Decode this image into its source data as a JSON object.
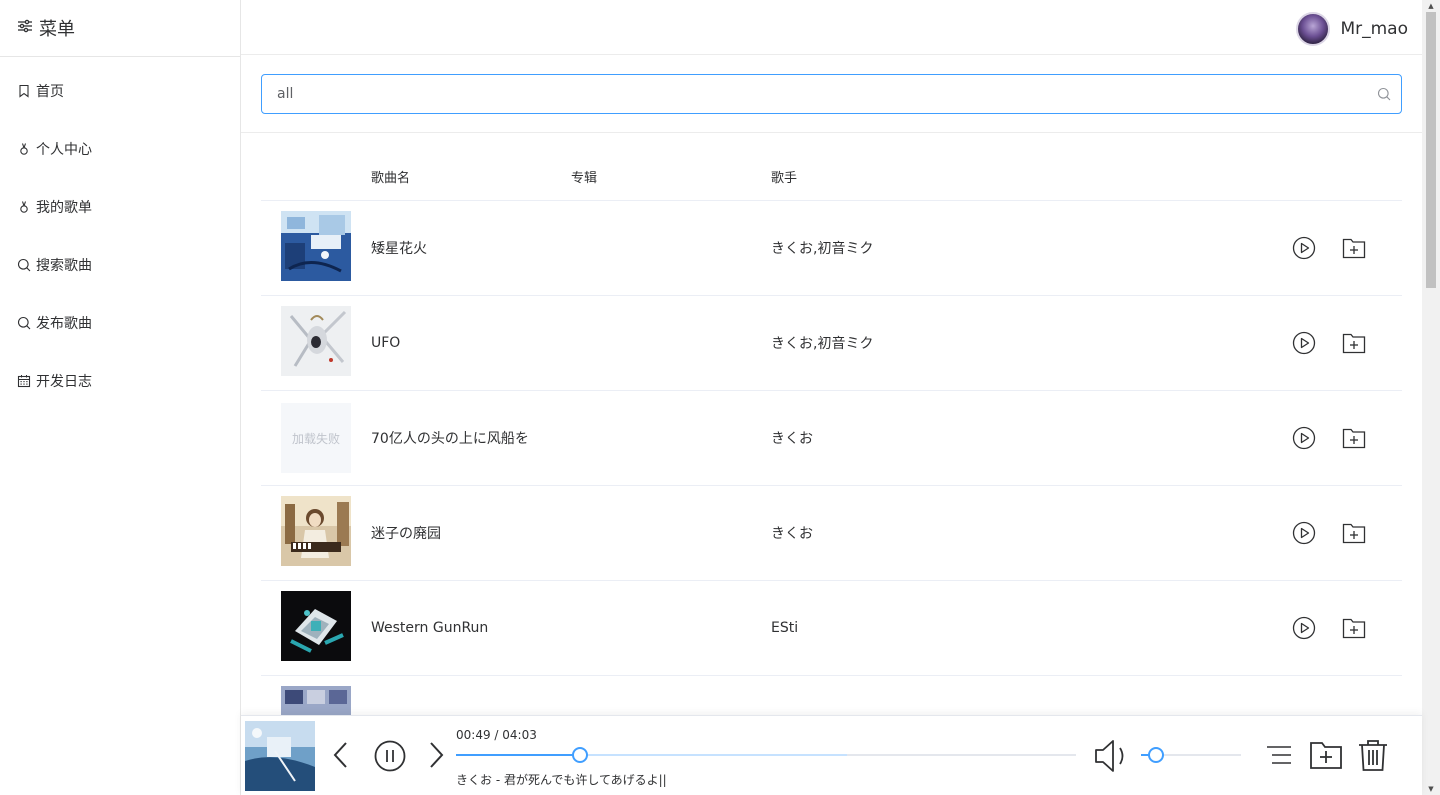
{
  "sidebar": {
    "title": "菜单",
    "items": [
      {
        "label": "首页",
        "icon": "bookmark-icon"
      },
      {
        "label": "个人中心",
        "icon": "user-icon"
      },
      {
        "label": "我的歌单",
        "icon": "user-icon"
      },
      {
        "label": "搜索歌曲",
        "icon": "search-icon"
      },
      {
        "label": "发布歌曲",
        "icon": "search-icon"
      },
      {
        "label": "开发日志",
        "icon": "calendar-icon"
      }
    ]
  },
  "header": {
    "username": "Mr_mao"
  },
  "search": {
    "value": "all"
  },
  "table": {
    "headers": {
      "name": "歌曲名",
      "album": "专辑",
      "artist": "歌手"
    },
    "rows": [
      {
        "name": "矮星花火",
        "album": "",
        "artist": "きくお,初音ミク",
        "cover": "blue"
      },
      {
        "name": "UFO",
        "album": "",
        "artist": "きくお,初音ミク",
        "cover": "white"
      },
      {
        "name": "70亿人の头の上に风船を",
        "album": "",
        "artist": "きくお",
        "cover": "failed",
        "cover_text": "加载失败"
      },
      {
        "name": "迷子の廃园",
        "album": "",
        "artist": "きくお",
        "cover": "sepia"
      },
      {
        "name": "Western GunRun",
        "album": "",
        "artist": "ESti",
        "cover": "dark"
      }
    ]
  },
  "player": {
    "time": "00:49 / 04:03",
    "progress": 0.2,
    "volume": 0.15,
    "lyric": "きくお - 君が死んでも许してあげるよ||"
  },
  "colors": {
    "accent": "#409eff",
    "border": "#e6e6e6"
  }
}
